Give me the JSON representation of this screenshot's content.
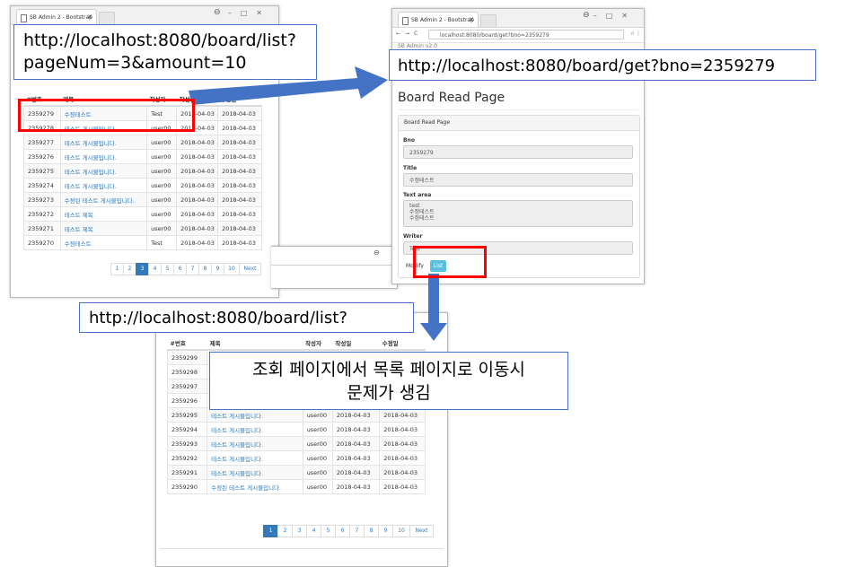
{
  "tab_title": "SB Admin 2 - Bootstrap",
  "callouts": {
    "list_url": "http://localhost:8080/board/list?\npageNum=3&amount=10",
    "get_url": "http://localhost:8080/board/get?bno=2359279",
    "list_url_plain": "http://localhost:8080/board/list?",
    "problem_note": "조회 페이지에서 목록 페이지로 이동시\n문제가 생김"
  },
  "list_headers": [
    "#번호",
    "제목",
    "작성자",
    "작성일",
    "수정일"
  ],
  "list_rows": [
    [
      "2359279",
      "수정테스트",
      "Test",
      "2018-04-03",
      "2018-04-03"
    ],
    [
      "2359278",
      "테스트 게시물입니다.",
      "user00",
      "2018-04-03",
      "2018-04-03"
    ],
    [
      "2359277",
      "테스트 게시물입니다.",
      "user00",
      "2018-04-03",
      "2018-04-03"
    ],
    [
      "2359276",
      "테스트 게시물입니다.",
      "user00",
      "2018-04-03",
      "2018-04-03"
    ],
    [
      "2359275",
      "테스트 게시물입니다.",
      "user00",
      "2018-04-03",
      "2018-04-03"
    ],
    [
      "2359274",
      "테스트 게시물입니다.",
      "user00",
      "2018-04-03",
      "2018-04-03"
    ],
    [
      "2359273",
      "수정된 테스트 게시물입니다.",
      "user00",
      "2018-04-03",
      "2018-04-03"
    ],
    [
      "2359272",
      "테스트 제목",
      "user00",
      "2018-04-03",
      "2018-04-03"
    ],
    [
      "2359271",
      "테스트 제목",
      "user00",
      "2018-04-03",
      "2018-04-03"
    ],
    [
      "2359270",
      "수정테스트",
      "Test",
      "2018-04-03",
      "2018-04-03"
    ]
  ],
  "pager_pages": [
    "1",
    "2",
    "3",
    "4",
    "5",
    "6",
    "7",
    "8",
    "9",
    "10",
    "Next"
  ],
  "pager_active_first": "3",
  "pager_active_second": "1",
  "read_window": {
    "address": "localhost:8080/board/get?bno=2359279",
    "site_header": "SB Admin v2.0",
    "title": "Board Read Page",
    "panel_heading": "Board Read Page",
    "bno_label": "Bno",
    "bno_value": "2359279",
    "title_label": "Title",
    "title_value": "수정테스트",
    "text_label": "Text area",
    "text_value": "test\n수정테스트\n수정테스트",
    "writer_label": "Writer",
    "writer_value": "Test",
    "modify_button": "Modify",
    "list_button": "List"
  },
  "second_list_rows": [
    [
      "2359299",
      "",
      "",
      "",
      ""
    ],
    [
      "2359298",
      "",
      "",
      "",
      ""
    ],
    [
      "2359297",
      "",
      "",
      "",
      ""
    ],
    [
      "2359296",
      "",
      "",
      "",
      ""
    ],
    [
      "2359295",
      "테스트 게시물입니다.",
      "user00",
      "2018-04-03",
      "2018-04-03"
    ],
    [
      "2359294",
      "테스트 게시물입니다.",
      "user00",
      "2018-04-03",
      "2018-04-03"
    ],
    [
      "2359293",
      "테스트 게시물입니다.",
      "user00",
      "2018-04-03",
      "2018-04-03"
    ],
    [
      "2359292",
      "테스트 게시물입니다.",
      "user00",
      "2018-04-03",
      "2018-04-03"
    ],
    [
      "2359291",
      "테스트 게시물입니다.",
      "user00",
      "2018-04-03",
      "2018-04-03"
    ],
    [
      "2359290",
      "수정된 테스트 게시물입니다.",
      "user00",
      "2018-04-03",
      "2018-04-03"
    ]
  ],
  "colors": {
    "arrow": "#4472c4",
    "highlight": "#ff0000",
    "link": "#337ab7",
    "active_page": "#337ab7",
    "list_button": "#5bc0de"
  }
}
